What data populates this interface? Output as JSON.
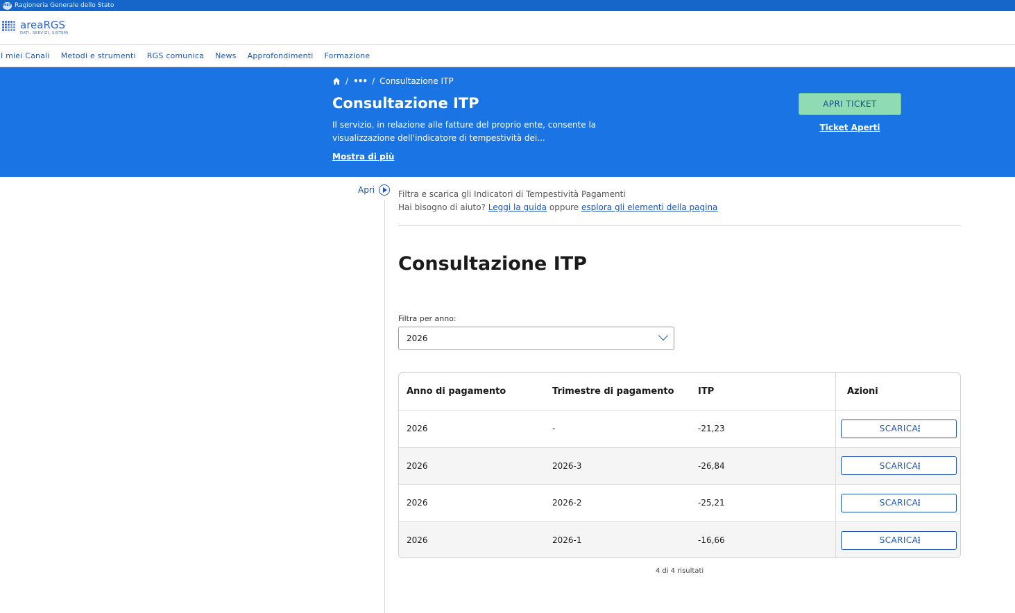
{
  "topbar": {
    "seal": "MEF",
    "title": "Ragioneria Generale dello Stato"
  },
  "logo": {
    "word": "areaRGS",
    "sub": "DATI, SERVIZI, SISTEMI"
  },
  "nav": [
    {
      "label": "I miei Canali"
    },
    {
      "label": "Metodi e strumenti"
    },
    {
      "label": "RGS comunica"
    },
    {
      "label": "News"
    },
    {
      "label": "Approfondimenti"
    },
    {
      "label": "Formazione"
    }
  ],
  "hero": {
    "breadcrumb_ellipsis": "•••",
    "breadcrumb_current": "Consultazione ITP",
    "title": "Consultazione ITP",
    "description": "Il servizio, in relazione alle fatture del proprio ente, consente la visualizzazione dell'indicatore di tempestività dei...",
    "more": "Mostra di più",
    "ticket_button": "APRI TICKET",
    "ticket_link": "Ticket Aperti"
  },
  "side": {
    "toggle": "Apri"
  },
  "intro": {
    "line1": "Filtra e scarica gli Indicatori di Tempestività Pagamenti",
    "help_prefix": "Hai bisogno di aiuto?",
    "guide_link": "Leggi la guida",
    "middle": "oppure",
    "explore_link": "esplora gli elementi della pagina"
  },
  "main": {
    "title": "Consultazione ITP",
    "filter_label": "Filtra per anno:",
    "filter_value": "2026"
  },
  "table": {
    "headers": [
      "Anno di pagamento",
      "Trimestre di pagamento",
      "ITP",
      "Azioni"
    ],
    "rows": [
      {
        "anno": "2026",
        "trimestre": "-",
        "itp": "-21,23",
        "action": "SCARICA"
      },
      {
        "anno": "2026",
        "trimestre": "2026-3",
        "itp": "-26,84",
        "action": "SCARICA"
      },
      {
        "anno": "2026",
        "trimestre": "2026-2",
        "itp": "-25,21",
        "action": "SCARICA"
      },
      {
        "anno": "2026",
        "trimestre": "2026-1",
        "itp": "-16,66",
        "action": "SCARICA"
      }
    ],
    "results": "4 di 4 risultati"
  },
  "colors": {
    "primary": "#1b74e4",
    "topbar": "#1666c9",
    "ticket_button": "#8fdcb4",
    "link": "#1c55b5"
  }
}
